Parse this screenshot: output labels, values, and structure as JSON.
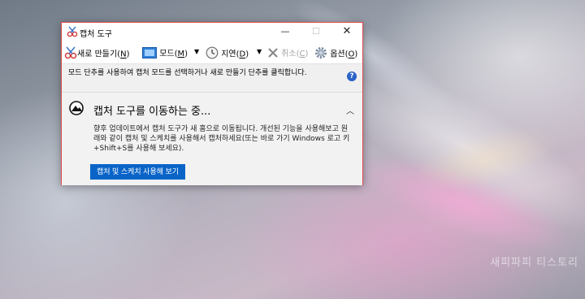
{
  "window": {
    "title": "캡처 도구",
    "minimize_glyph": "—",
    "maximize_glyph": "☐",
    "close_glyph": "✕"
  },
  "toolbar": {
    "new_prefix": "새로 만들기(",
    "new_key": "N",
    "mode_prefix": "모드(",
    "mode_key": "M",
    "delay_prefix": "지연(",
    "delay_key": "D",
    "cancel_prefix": "취소(",
    "cancel_key": "C",
    "options_prefix": "옵션(",
    "options_key": "O",
    "close_paren": ")",
    "dropdown_glyph": "▼"
  },
  "description": {
    "text": "모드 단추를 사용하여 캡처 모드를 선택하거나 새로 만들기 단추를 클릭합니다.",
    "help_glyph": "?"
  },
  "notice": {
    "title": "캡처 도구를 이동하는 중...",
    "body": "향후 업데이트에서 캡처 도구가 새 홈으로 이동됩니다. 개선된 기능을 사용해보고 원래와 같이 캡처 및 스케치를 사용해서 캡처하세요(또는 바로 가기 Windows 로고 키+Shift+S를 사용해 보세요).",
    "button_label": "캡처 및 스케치 사용해 보기",
    "collapse_glyph": "︿"
  },
  "desktop": {
    "watermark": "새피파피 티스토리"
  },
  "colors": {
    "window_border": "#e04848",
    "button_blue": "#0a64c8",
    "help_blue": "#2a63c8"
  }
}
